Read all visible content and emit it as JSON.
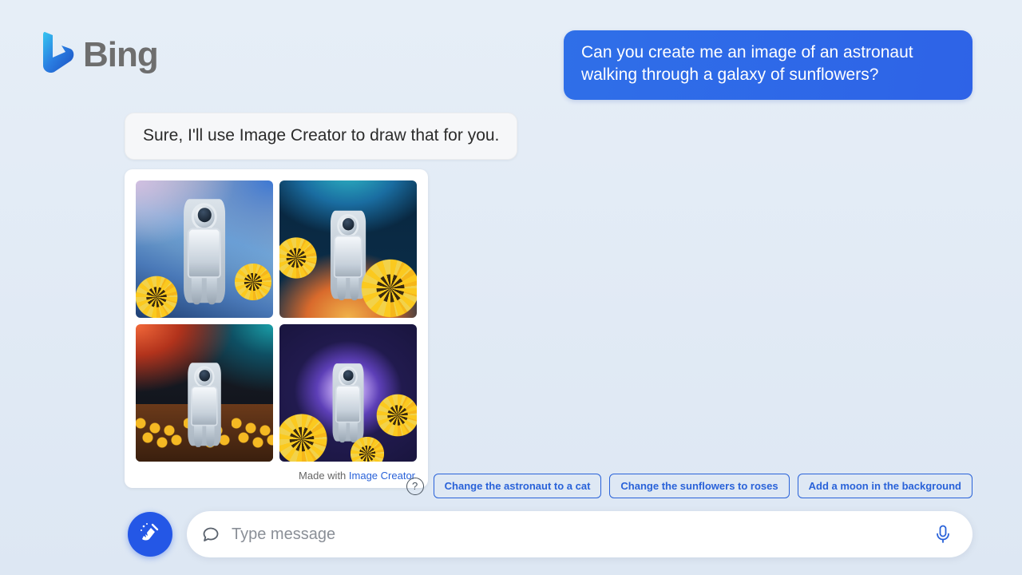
{
  "brand": {
    "name": "Bing"
  },
  "user_message": "Can you create me an image of an astronaut walking through a galaxy of sunflowers?",
  "assistant_message": "Sure, I'll use Image Creator to draw that for you.",
  "image_card": {
    "credit_prefix": "Made with ",
    "credit_link": "Image Creator",
    "tiles": [
      {
        "alt": "astronaut-galaxy-sunflowers-1"
      },
      {
        "alt": "astronaut-galaxy-sunflowers-2"
      },
      {
        "alt": "astronaut-galaxy-sunflowers-3"
      },
      {
        "alt": "astronaut-galaxy-sunflowers-4"
      }
    ]
  },
  "help_glyph": "?",
  "suggestions": [
    "Change the astronaut to a cat",
    "Change the sunflowers to roses",
    "Add a moon in the background"
  ],
  "composer": {
    "placeholder": "Type message"
  }
}
